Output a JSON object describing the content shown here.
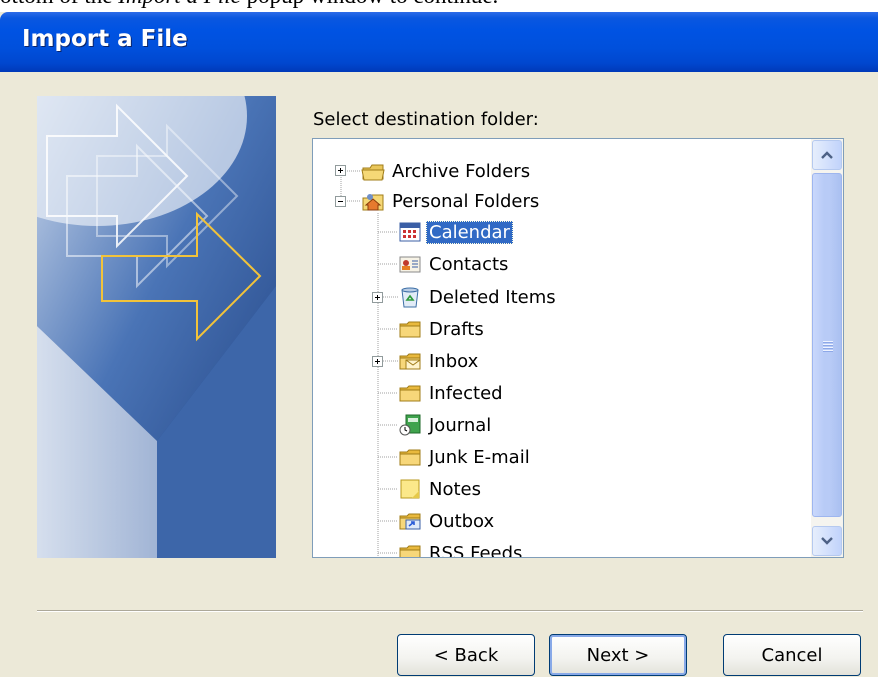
{
  "document": {
    "caption_before": "ottom of the ",
    "caption_em": "Import a File",
    "caption_after": " popup window to continue."
  },
  "dialog": {
    "title": "Import a File",
    "prompt": "Select destination folder:"
  },
  "tree": {
    "items": [
      {
        "label": "Archive Folders",
        "icon": "archive-folders-icon",
        "expander": "plus",
        "selected": false
      },
      {
        "label": "Personal Folders",
        "icon": "personal-folders-icon",
        "expander": "minus",
        "selected": false
      },
      {
        "label": "Calendar",
        "icon": "calendar-icon",
        "expander": "",
        "selected": true
      },
      {
        "label": "Contacts",
        "icon": "contacts-icon",
        "expander": "",
        "selected": false
      },
      {
        "label": "Deleted Items",
        "icon": "deleted-items-icon",
        "expander": "plus",
        "selected": false
      },
      {
        "label": "Drafts",
        "icon": "folder-icon",
        "expander": "",
        "selected": false
      },
      {
        "label": "Inbox",
        "icon": "inbox-icon",
        "expander": "plus",
        "selected": false
      },
      {
        "label": "Infected",
        "icon": "folder-icon",
        "expander": "",
        "selected": false
      },
      {
        "label": "Journal",
        "icon": "journal-icon",
        "expander": "",
        "selected": false
      },
      {
        "label": "Junk E-mail",
        "icon": "folder-icon",
        "expander": "",
        "selected": false
      },
      {
        "label": "Notes",
        "icon": "notes-icon",
        "expander": "",
        "selected": false
      },
      {
        "label": "Outbox",
        "icon": "outbox-icon",
        "expander": "",
        "selected": false
      },
      {
        "label": "RSS Feeds",
        "icon": "folder-icon",
        "expander": "",
        "selected": false
      }
    ]
  },
  "buttons": {
    "back": "< Back",
    "next": "Next >",
    "cancel": "Cancel"
  },
  "colors": {
    "titlebar": "#0054e3",
    "dialog_bg": "#ece9d8",
    "selection": "#316ac5",
    "tree_border": "#7f9db9"
  }
}
